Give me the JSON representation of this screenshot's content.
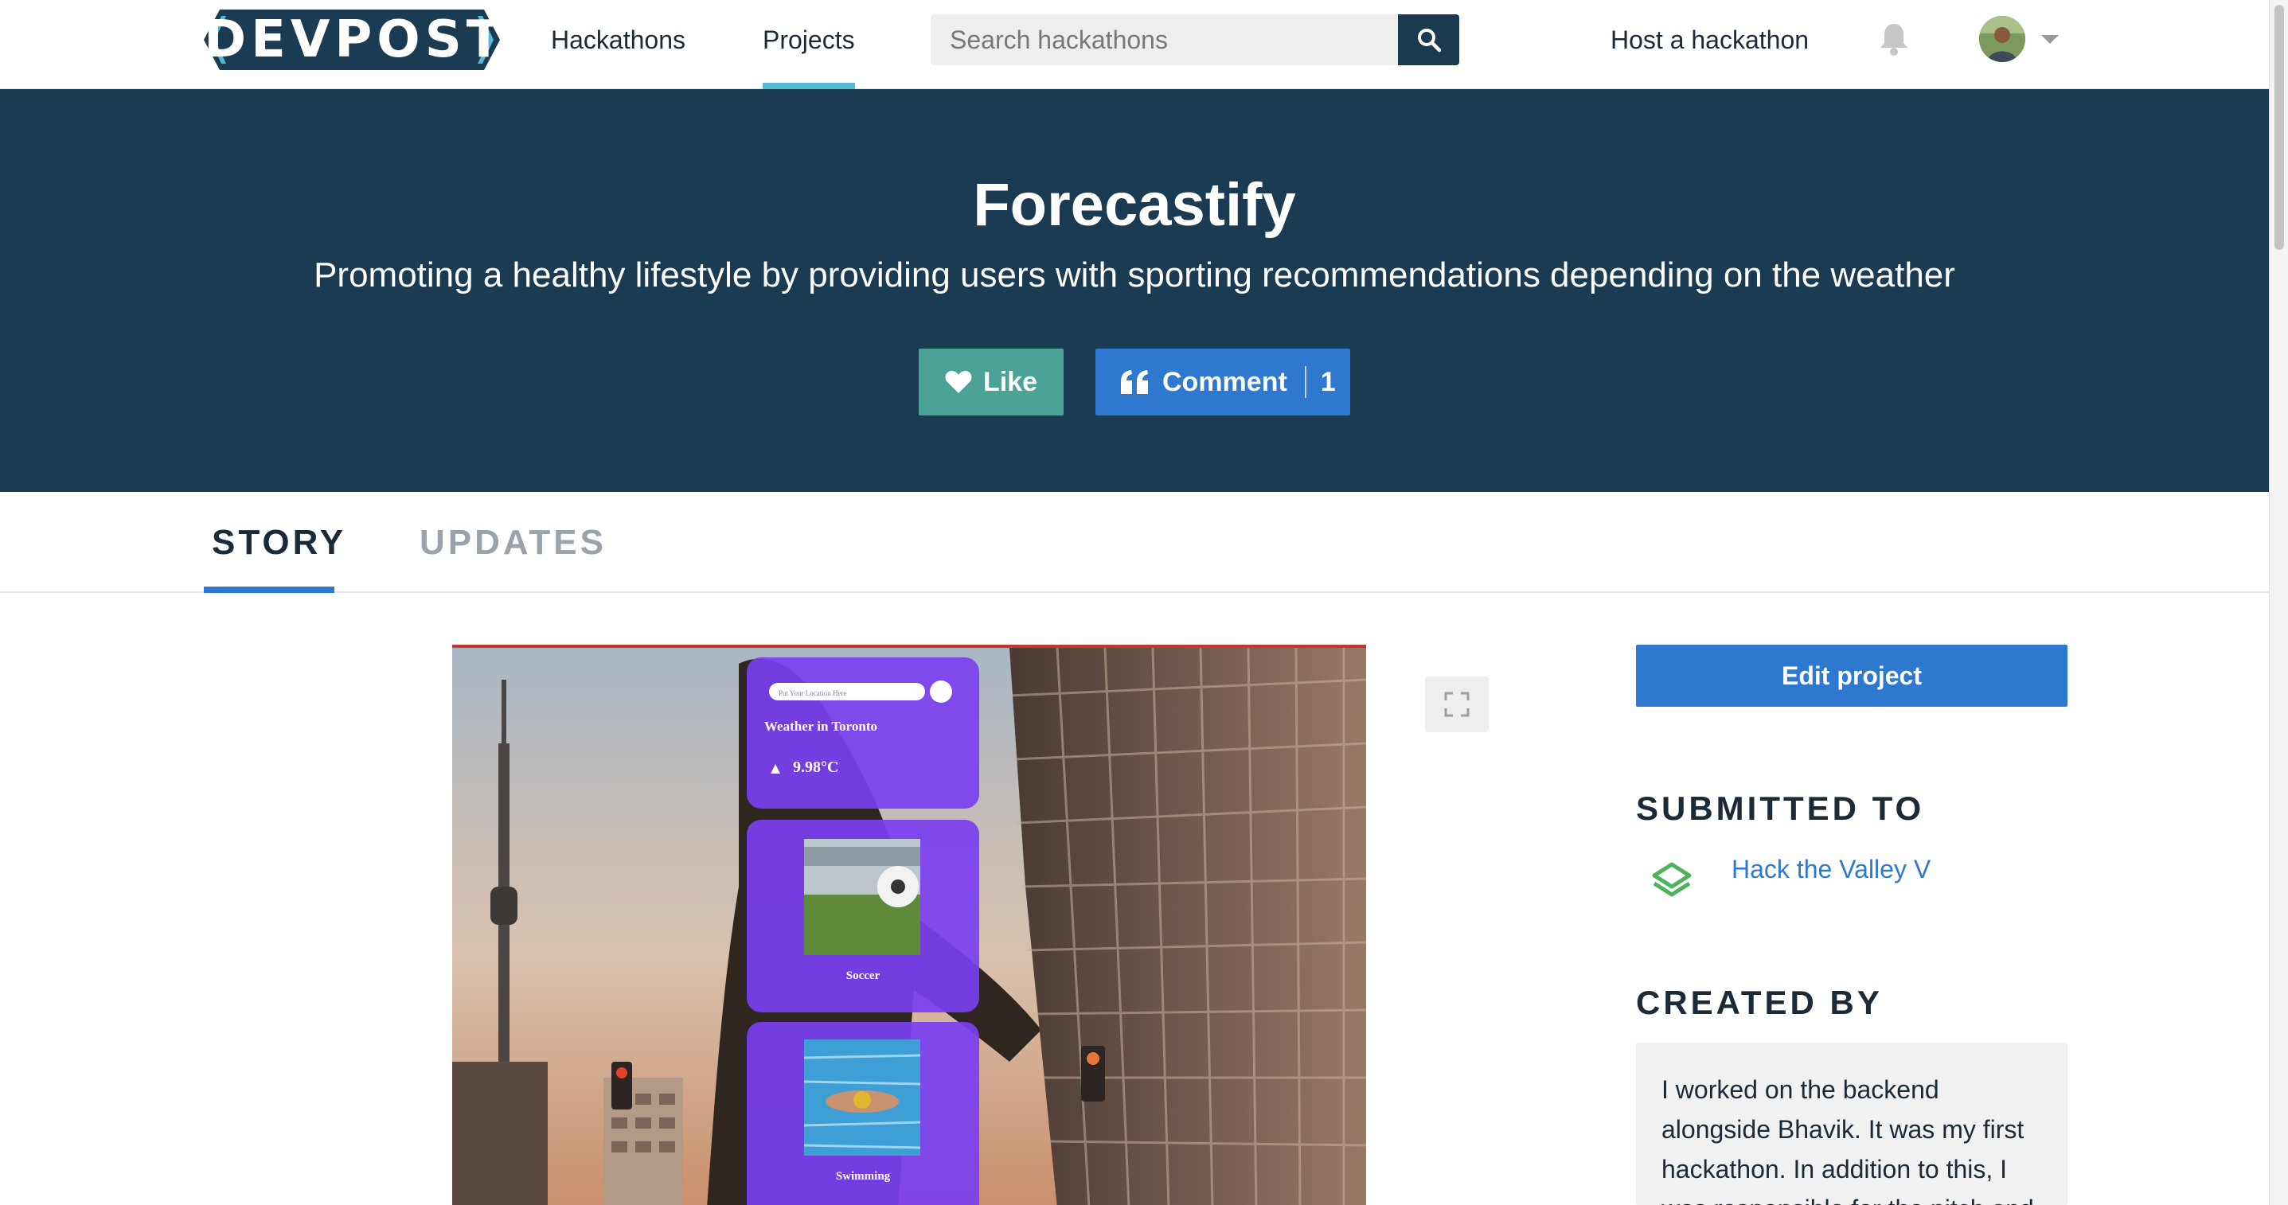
{
  "nav": {
    "logo_text": "DEVPOST",
    "hackathons": "Hackathons",
    "projects": "Projects",
    "search_placeholder": "Search hackathons",
    "host": "Host a hackathon"
  },
  "hero": {
    "title": "Forecastify",
    "tagline": "Promoting a healthy lifestyle by providing users with sporting recommendations depending on the weather",
    "like_label": "Like",
    "comment_label": "Comment",
    "comment_count": "1"
  },
  "tabs": {
    "story": "STORY",
    "updates": "UPDATES"
  },
  "media": {
    "app_location_placeholder": "Put Your Location Here",
    "app_weather_title": "Weather in Toronto",
    "app_temperature": "9.98°C",
    "app_sport_1": "Soccer",
    "app_sport_2": "Swimming"
  },
  "sidebar": {
    "edit_label": "Edit project",
    "submitted_heading": "SUBMITTED TO",
    "hackathon_name": "Hack the Valley V",
    "created_heading": "CREATED BY",
    "created_text": "I worked on the backend alongside Bhavik. It was my first hackathon. In addition to this, I was responsible for the pitch and"
  },
  "colors": {
    "hero_bg": "#1a3b52",
    "like_green": "#4aa396",
    "accent_blue": "#2f78d0",
    "nav_underline": "#56b9d1",
    "app_purple": "#7b3ff0"
  },
  "icons": [
    "search-icon",
    "bell-icon",
    "heart-icon",
    "quote-icon",
    "expand-icon",
    "hackathon-logo-icon",
    "chevron-down-icon"
  ]
}
